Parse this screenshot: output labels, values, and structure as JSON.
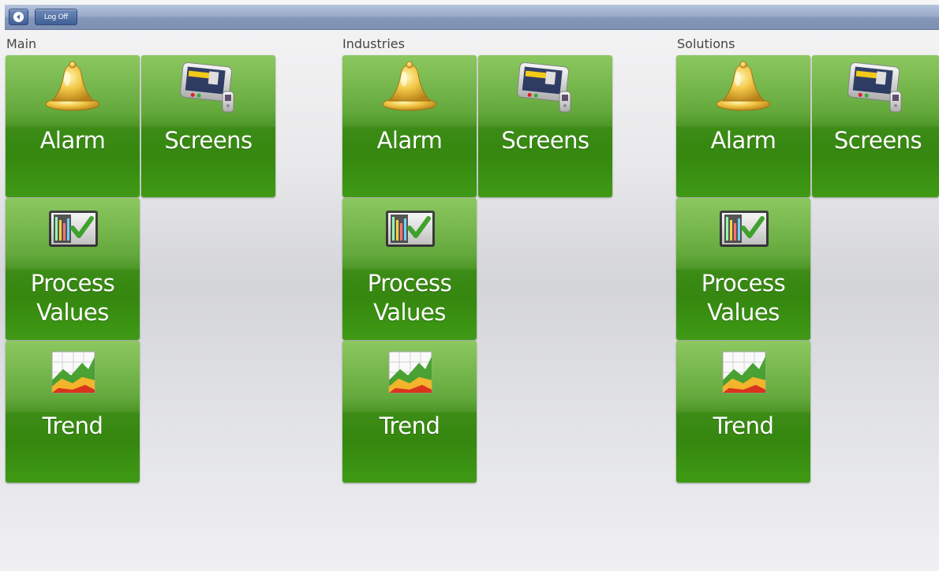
{
  "toolbar": {
    "back_icon": "back-arrow-icon",
    "logoff_label": "Log Off"
  },
  "sections": [
    {
      "title": "Main",
      "tiles": [
        {
          "label": "Alarm",
          "icon": "bell-icon"
        },
        {
          "label": "Screens",
          "icon": "panel-screens-icon"
        },
        {
          "label_line1": "Process",
          "label_line2": "Values",
          "icon": "process-values-icon"
        },
        {
          "label": "Trend",
          "icon": "trend-chart-icon"
        }
      ]
    },
    {
      "title": "Industries",
      "tiles": [
        {
          "label": "Alarm",
          "icon": "bell-icon"
        },
        {
          "label": "Screens",
          "icon": "panel-screens-icon"
        },
        {
          "label_line1": "Process",
          "label_line2": "Values",
          "icon": "process-values-icon"
        },
        {
          "label": "Trend",
          "icon": "trend-chart-icon"
        }
      ]
    },
    {
      "title": "Solutions",
      "tiles": [
        {
          "label": "Alarm",
          "icon": "bell-icon"
        },
        {
          "label": "Screens",
          "icon": "panel-screens-icon"
        },
        {
          "label_line1": "Process",
          "label_line2": "Values",
          "icon": "process-values-icon"
        },
        {
          "label": "Trend",
          "icon": "trend-chart-icon"
        }
      ]
    }
  ],
  "colors": {
    "tile_green": "#4b9423",
    "topbar_blue": "#9aabc9"
  }
}
